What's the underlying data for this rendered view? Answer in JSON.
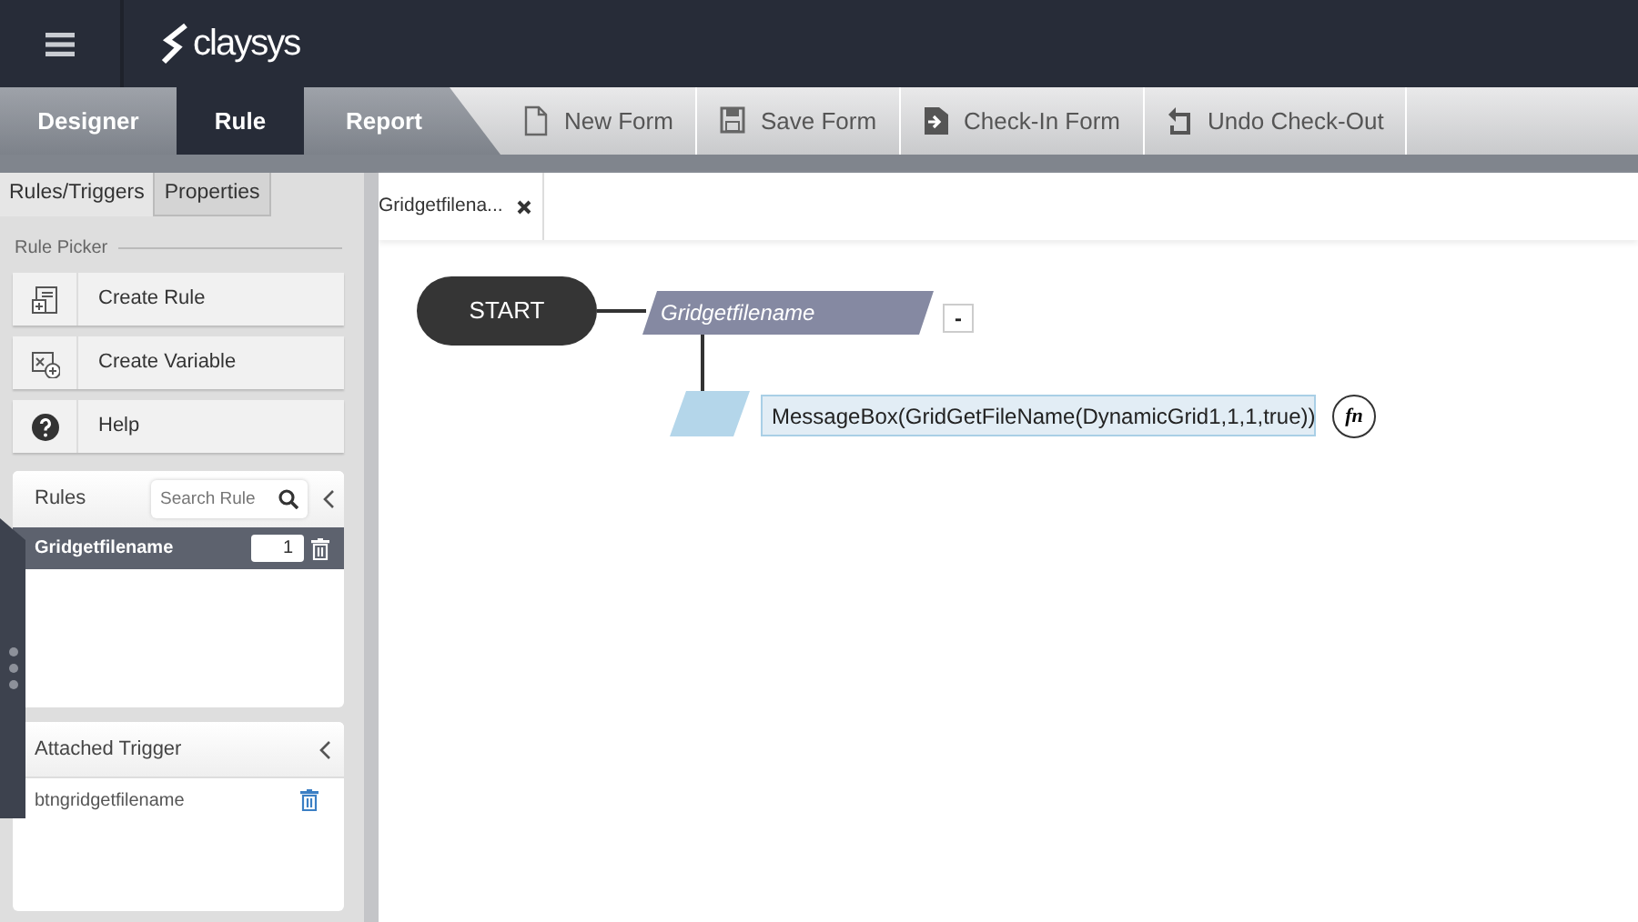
{
  "header": {
    "logo": "claysys"
  },
  "mode_tabs": [
    {
      "label": "Designer",
      "selected": false
    },
    {
      "label": "Rule",
      "selected": true
    },
    {
      "label": "Report",
      "selected": false
    }
  ],
  "toolbar": [
    {
      "label": "New Form",
      "kind": "new"
    },
    {
      "label": "Save Form",
      "kind": "save"
    },
    {
      "label": "Check-In Form",
      "kind": "checkin"
    },
    {
      "label": "Undo Check-Out",
      "kind": "undo"
    }
  ],
  "sidebar": {
    "tabs": [
      {
        "label": "Rules/Triggers",
        "selected": true
      },
      {
        "label": "Properties",
        "selected": false
      }
    ],
    "section_label": "Rule Picker",
    "picker_buttons": [
      {
        "label": "Create Rule",
        "kind": "rule"
      },
      {
        "label": "Create Variable",
        "kind": "variable"
      },
      {
        "label": "Help",
        "kind": "help"
      }
    ],
    "rules_panel": {
      "title": "Rules",
      "search_placeholder": "Search Rule",
      "items": [
        {
          "name": "Gridgetfilename",
          "count": "1",
          "selected": true
        }
      ]
    },
    "trigger_panel": {
      "title": "Attached Trigger",
      "items": [
        {
          "name": "btngridgetfilename"
        }
      ]
    }
  },
  "document_tabs": [
    {
      "label": "Gridgetfilena...",
      "selected": true
    }
  ],
  "canvas": {
    "start": "START",
    "rule": "Gridgetfilename",
    "collapse": "-",
    "action": "MessageBox(GridGetFileName(DynamicGrid1,1,1,true))",
    "function_label": "fn"
  }
}
